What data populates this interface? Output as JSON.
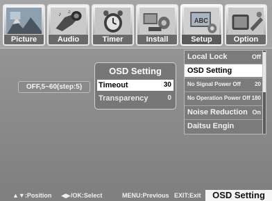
{
  "tabs": [
    {
      "label": "Picture",
      "icon": "picture-icon"
    },
    {
      "label": "Audio",
      "icon": "audio-icon"
    },
    {
      "label": "Timer",
      "icon": "timer-icon"
    },
    {
      "label": "Install",
      "icon": "install-icon"
    },
    {
      "label": "Setup",
      "icon": "setup-icon"
    },
    {
      "label": "Option",
      "icon": "option-icon"
    }
  ],
  "active_tab": "Setup",
  "submenu": [
    {
      "label": "Local Lock",
      "value": "Off"
    },
    {
      "label": "OSD Setting",
      "value": ""
    },
    {
      "label": "No Signal Power Off",
      "value": "20"
    },
    {
      "label": "No Operation Power Off",
      "value": "180"
    },
    {
      "label": "Noise Reduction",
      "value": "On"
    },
    {
      "label": "Daitsu Engin",
      "value": ""
    }
  ],
  "hint": "OFF,5~60(step:5)",
  "osd_panel": {
    "title": "OSD Setting",
    "rows": [
      {
        "label": "Timeout",
        "value": "30"
      },
      {
        "label": "Transparency",
        "value": "0"
      }
    ]
  },
  "help_bar": {
    "position": "▲▼:Position",
    "select": "◀▶/OK:Select",
    "previous": "MENU:Previous",
    "exit": "EXIT:Exit"
  },
  "mode_title": "OSD Setting",
  "colors": {
    "background": "#8e8e8e",
    "selected_row": "#ffffff",
    "panel": "#777777"
  }
}
